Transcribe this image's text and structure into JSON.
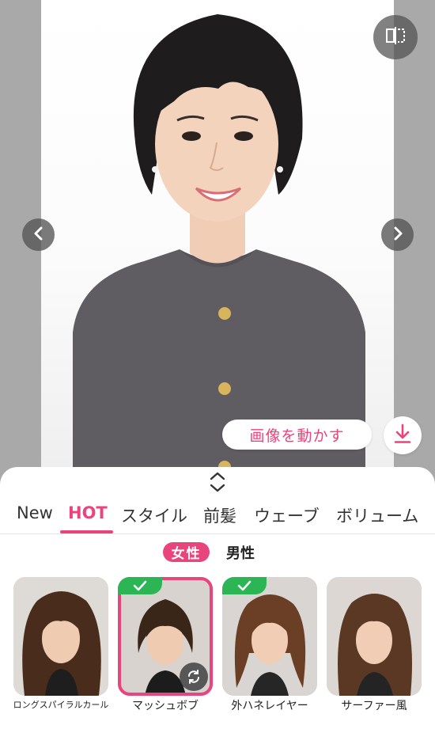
{
  "colors": {
    "accent": "#e9457d",
    "check_green": "#2bb554",
    "side_gray": "#a9a9a9"
  },
  "photo": {
    "compare_icon": "compare-split-icon",
    "prev_icon": "chevron-left-icon",
    "next_icon": "chevron-right-icon",
    "animate_label": "画像を動かす",
    "download_icon": "download-icon"
  },
  "sheet": {
    "handle_icon": "expand-collapse-icon",
    "tabs": [
      {
        "label": "New"
      },
      {
        "label": "HOT",
        "active": true
      },
      {
        "label": "スタイル"
      },
      {
        "label": "前髪"
      },
      {
        "label": "ウェーブ"
      },
      {
        "label": "ボリューム"
      }
    ],
    "gender": {
      "female": "女性",
      "male": "男性",
      "selected": "女性"
    },
    "styles": [
      {
        "label": "ロングスパイラルカール",
        "selected": false
      },
      {
        "label": "マッシュボブ",
        "selected": true
      },
      {
        "label": "外ハネレイヤー",
        "selected": false
      },
      {
        "label": "サーファー風",
        "selected": false
      }
    ]
  }
}
